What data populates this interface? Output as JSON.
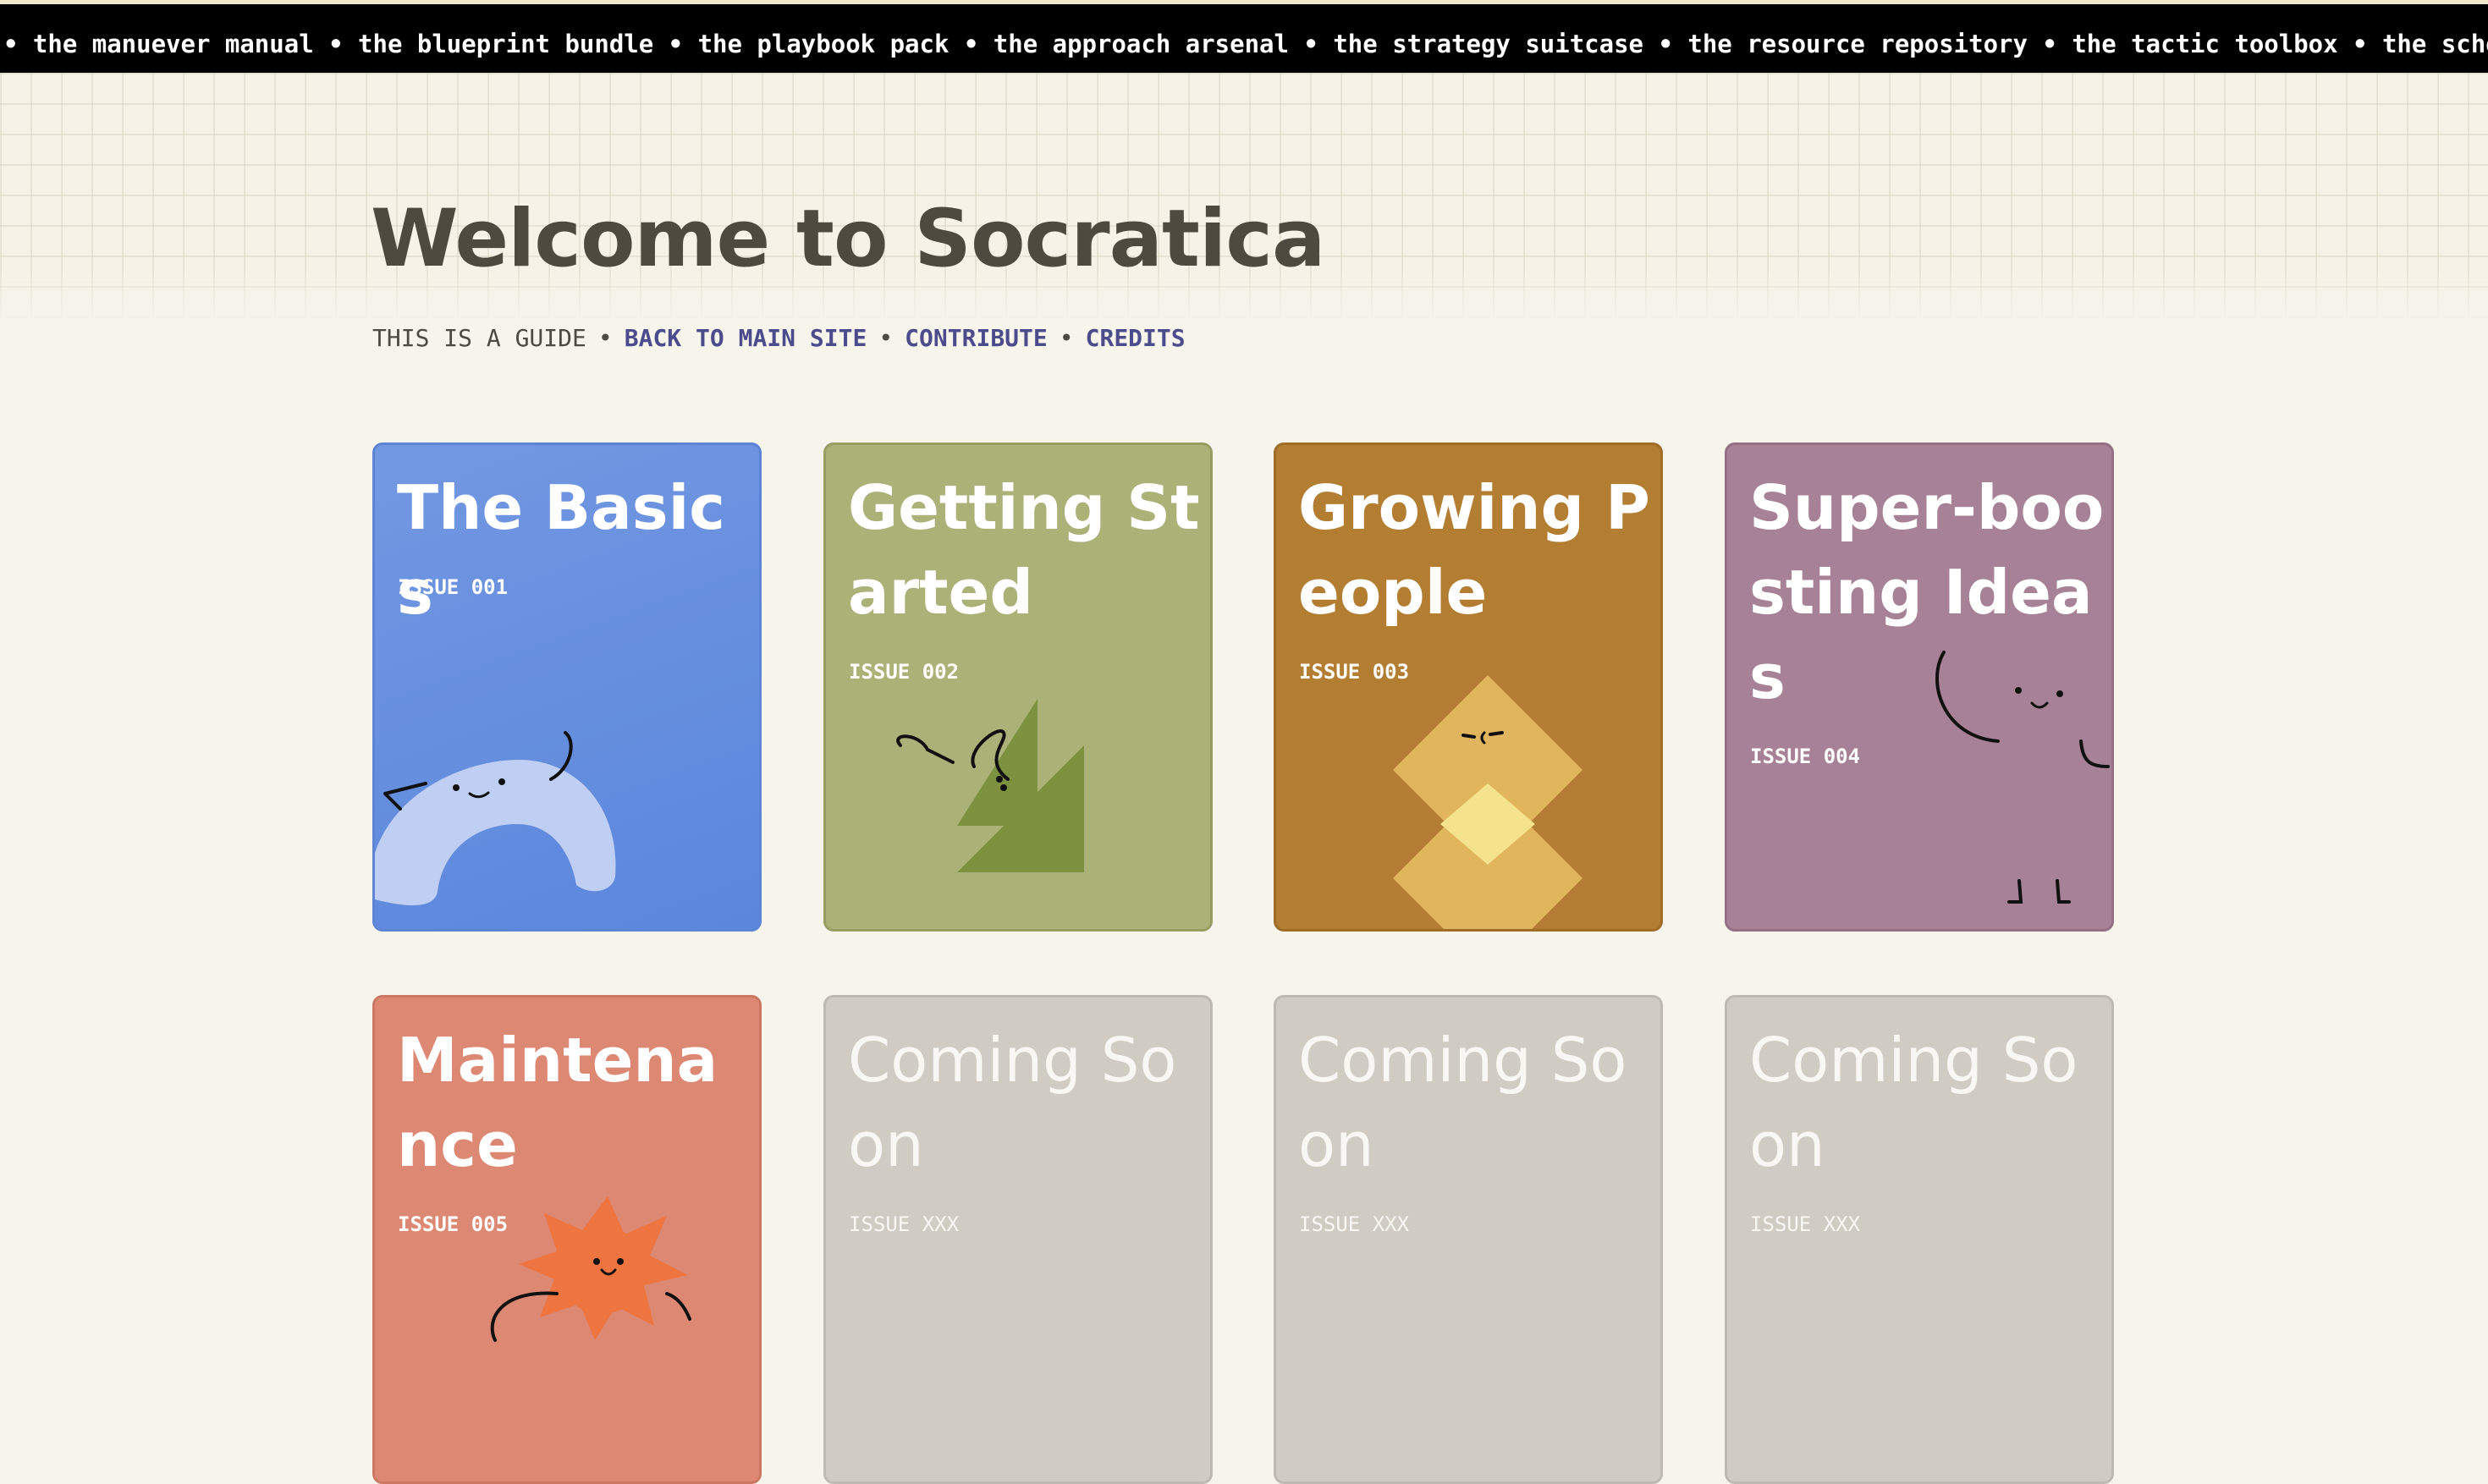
{
  "ticker": {
    "text": "• the manuever manual • the blueprint bundle • the playbook pack • the approach arsenal • the strategy suitcase • the resource repository • the tactic toolbox • the scheme suite • the manuever manual • the blueprint bundle"
  },
  "header": {
    "title": "Welcome to Socratica",
    "lead": "THIS IS A GUIDE",
    "separator": "•",
    "links": {
      "back": "BACK TO MAIN SITE",
      "contribute": "CONTRIBUTE",
      "credits": "CREDITS"
    }
  },
  "cards": [
    {
      "title": "The Basics",
      "issue": "ISSUE 001",
      "color": "#6b93e0"
    },
    {
      "title": "Getting Started",
      "issue": "ISSUE 002",
      "color": "#abb278"
    },
    {
      "title": "Growing People",
      "issue": "ISSUE 003",
      "color": "#b37d32"
    },
    {
      "title": "Super-boosting Ideas",
      "issue": "ISSUE 004",
      "color": "#a78195"
    },
    {
      "title": "Maintenance",
      "issue": "ISSUE 005",
      "color": "#dc8872"
    },
    {
      "title": "Coming Soon",
      "issue": "ISSUE XXX",
      "color": "#d0ccc4"
    },
    {
      "title": "Coming Soon",
      "issue": "ISSUE XXX",
      "color": "#d0ccc4"
    },
    {
      "title": "Coming Soon",
      "issue": "ISSUE XXX",
      "color": "#d0ccc4"
    }
  ],
  "icons": {
    "card1": "arch-creature-icon",
    "card2": "triangle-creature-icon",
    "card3": "diamond-creature-icon",
    "card4": "doodle-creature-icon",
    "card5": "sun-creature-icon"
  }
}
